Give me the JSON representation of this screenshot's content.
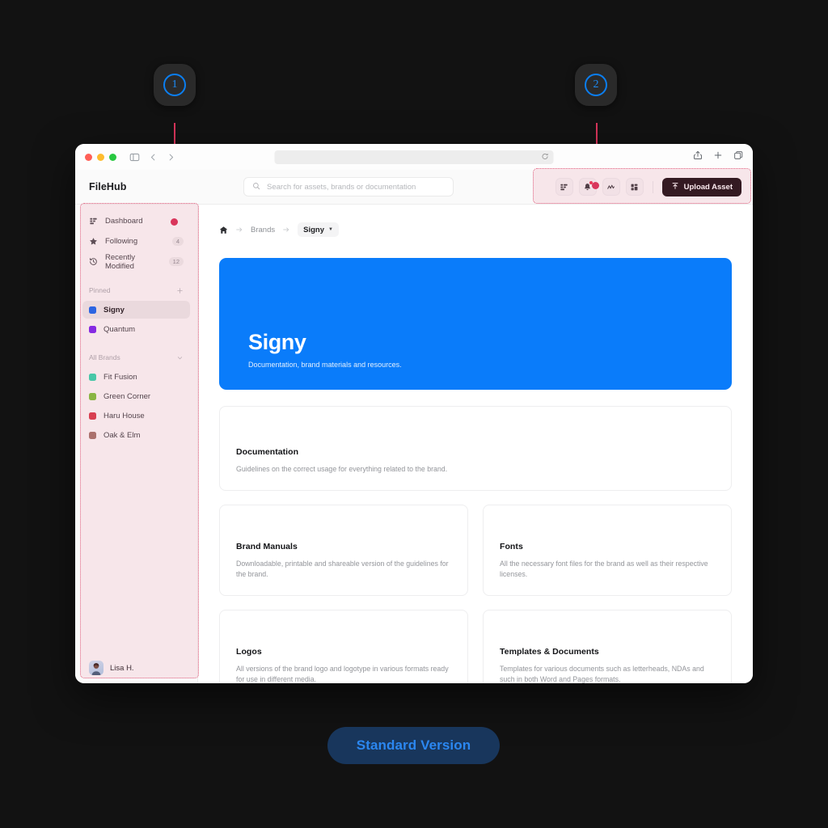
{
  "annotations": {
    "markers": [
      {
        "number": "1",
        "target": "sidebar"
      },
      {
        "number": "2",
        "target": "header-toolbar"
      }
    ],
    "version_label": "Standard Version",
    "accent_color": "#2b87f0",
    "highlight_color": "#e0607f"
  },
  "browser": {
    "url_value": "",
    "reload_icon": "reload-icon",
    "share_icon": "share-icon",
    "newtab_icon": "plus-icon",
    "tabs_icon": "copy-tabs-icon",
    "sidebar_toggle_icon": "sidebar-toggle-icon",
    "back_icon": "chevron-left-icon",
    "forward_icon": "chevron-right-icon"
  },
  "header": {
    "brand": "FileHub",
    "search": {
      "placeholder": "Search for assets, brands or documentation",
      "value": "",
      "icon": "search-icon"
    },
    "tools": [
      {
        "name": "dashboard-grid-icon",
        "label": "Dashboard view",
        "badge": false
      },
      {
        "name": "notifications-bell-icon",
        "label": "Notifications",
        "badge": true
      },
      {
        "name": "analytics-icon",
        "label": "Analytics",
        "badge": false
      },
      {
        "name": "apps-icon",
        "label": "Apps",
        "badge": false
      }
    ],
    "upload_label": "Upload Asset",
    "upload_icon": "upload-arrow-icon"
  },
  "sidebar": {
    "nav": [
      {
        "label": "Dashboard",
        "icon": "dashboard-icon",
        "count": ""
      },
      {
        "label": "Following",
        "icon": "star-icon",
        "count": "4"
      },
      {
        "label": "Recently Modified",
        "icon": "history-clock-icon",
        "count": "12"
      }
    ],
    "pinned": {
      "title": "Pinned",
      "action_icon": "plus-icon",
      "items": [
        {
          "label": "Signy",
          "color": "#1266f1",
          "active": true
        },
        {
          "label": "Quantum",
          "color": "#7822f0",
          "active": false
        }
      ]
    },
    "all_brands": {
      "title": "All Brands",
      "action_icon": "chevron-down-icon",
      "items": [
        {
          "label": "Fit Fusion",
          "color": "#31d6ae"
        },
        {
          "label": "Green Corner",
          "color": "#7cc23b"
        },
        {
          "label": "Haru House",
          "color": "#d63a4a"
        },
        {
          "label": "Oak & Elm",
          "color": "#a3736a"
        }
      ]
    },
    "user": {
      "name": "Lisa H.",
      "avatar": "user-avatar"
    }
  },
  "main": {
    "breadcrumb": {
      "home_icon": "home-icon",
      "arrow_icon": "arrow-right-icon",
      "brands_label": "Brands",
      "current_label": "Signy",
      "caret_icon": "caret-down-icon"
    },
    "hero": {
      "title": "Signy",
      "subtitle": "Documentation, brand materials and resources.",
      "background_color": "#0a7cfa"
    },
    "cards": [
      {
        "title": "Documentation",
        "description": "Guidelines on the correct usage for everything related to the brand."
      },
      {
        "title": "Brand Manuals",
        "description": "Downloadable, printable and shareable version of the guidelines for the brand."
      },
      {
        "title": "Fonts",
        "description": "All the necessary font files for the brand as well as their respective licenses."
      },
      {
        "title": "Logos",
        "description": "All versions of the brand logo and logotype in various formats ready for use in different media."
      },
      {
        "title": "Templates & Documents",
        "description": "Templates for various documents such as letterheads, NDAs and such in both Word and Pages formats."
      }
    ]
  }
}
